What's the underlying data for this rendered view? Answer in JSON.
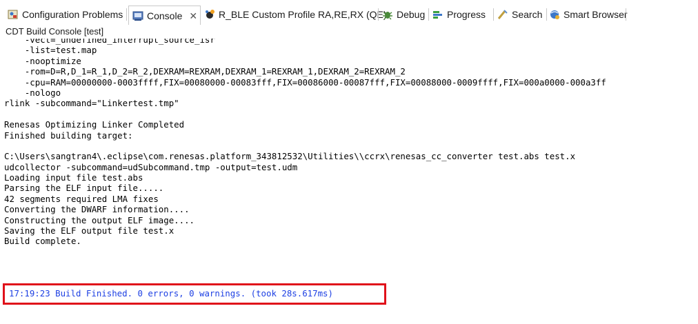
{
  "tabs": [
    {
      "label": "Configuration Problems",
      "icon": "configuration-problems-icon"
    },
    {
      "label": "Console",
      "icon": "console-icon",
      "active": true
    },
    {
      "label": "R_BLE Custom Profile RA,RE,RX (QE)",
      "icon": "ble-profile-icon"
    },
    {
      "label": "Debug",
      "icon": "debug-icon"
    },
    {
      "label": "Progress",
      "icon": "progress-icon"
    },
    {
      "label": "Search",
      "icon": "search-icon"
    },
    {
      "label": "Smart Browser",
      "icon": "smart-browser-icon"
    }
  ],
  "close_glyph": "✕",
  "console_title": "CDT Build Console [test]",
  "console_lines": [
    "    -vect=_undefined_interrupt_source_isr",
    "    -list=test.map",
    "    -nooptimize",
    "    -rom=D=R,D_1=R_1,D_2=R_2,DEXRAM=REXRAM,DEXRAM_1=REXRAM_1,DEXRAM_2=REXRAM_2",
    "    -cpu=RAM=00000000-0003ffff,FIX=00080000-00083fff,FIX=00086000-00087fff,FIX=00088000-0009ffff,FIX=000a0000-000a3ff",
    "    -nologo",
    "rlink -subcommand=\"Linkertest.tmp\"",
    "",
    "Renesas Optimizing Linker Completed",
    "Finished building target:",
    "",
    "C:\\Users\\sangtran4\\.eclipse\\com.renesas.platform_343812532\\Utilities\\\\ccrx\\renesas_cc_converter test.abs test.x",
    "udcollector -subcommand=udSubcommand.tmp -output=test.udm",
    "Loading input file test.abs",
    "Parsing the ELF input file.....",
    "42 segments required LMA fixes",
    "Converting the DWARF information....",
    "Constructing the output ELF image....",
    "Saving the ELF output file test.x",
    "Build complete."
  ],
  "build_finished_line": "17:19:23 Build Finished. 0 errors, 0 warnings. (took 28s.617ms)",
  "colors": {
    "finished_text": "#1c3fe3",
    "highlight_border": "#e0101a"
  }
}
